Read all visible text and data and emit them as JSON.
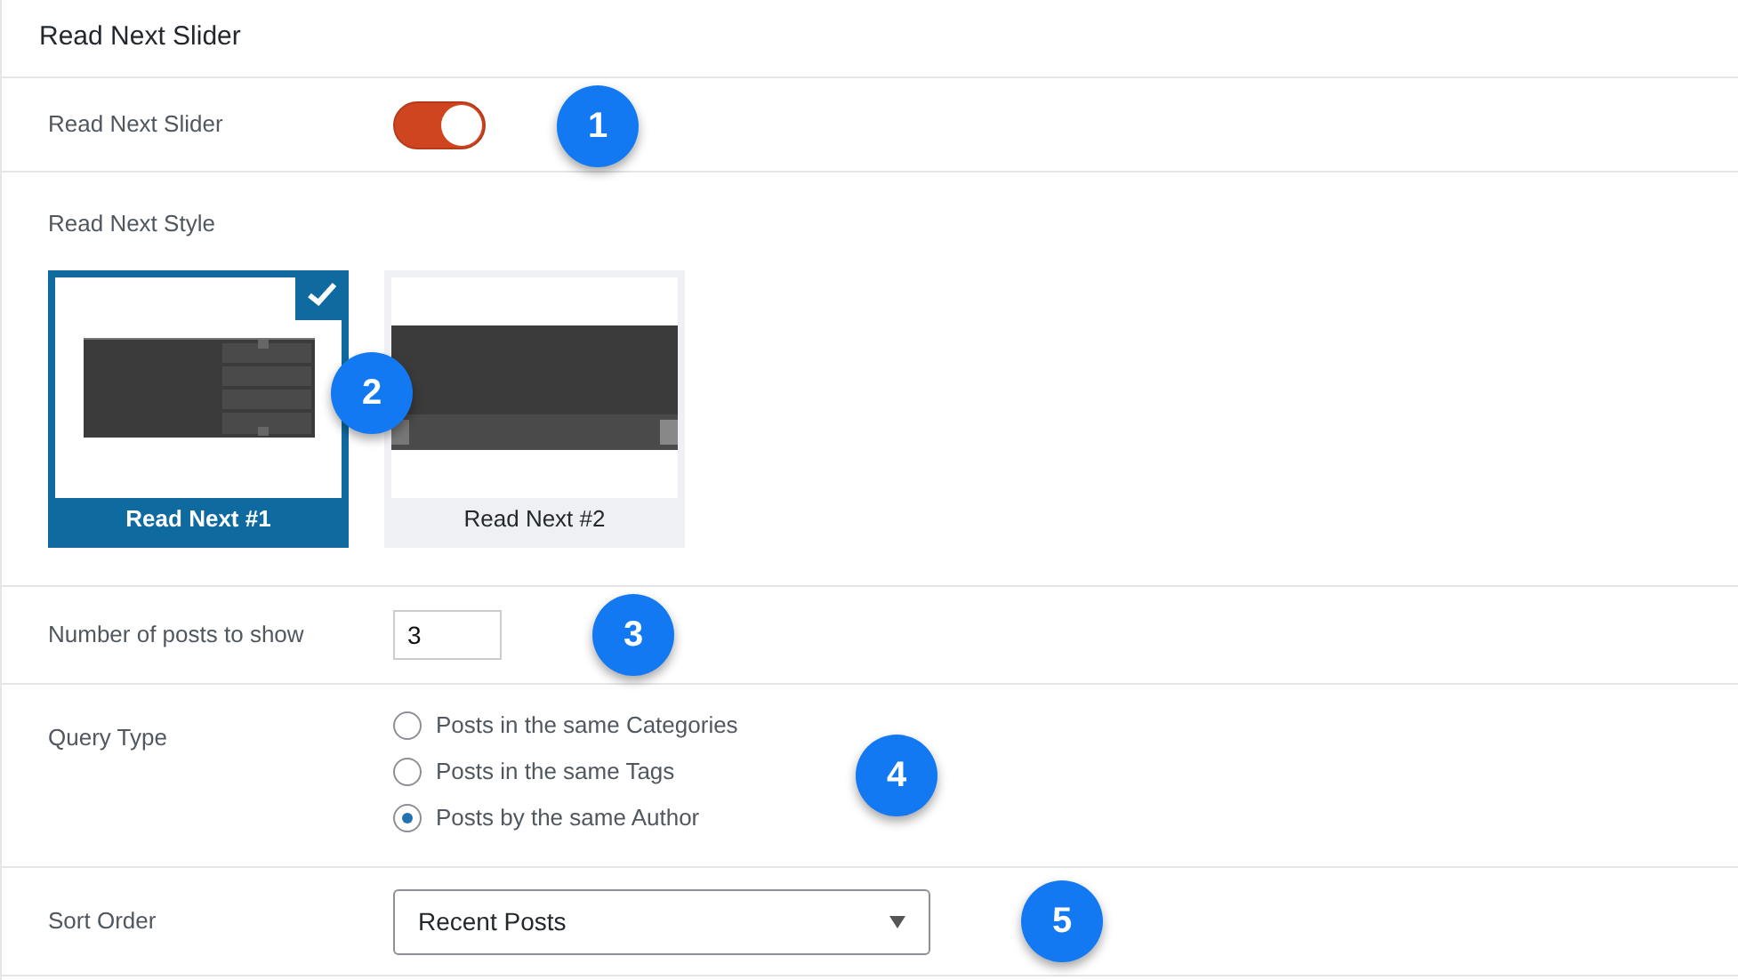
{
  "panel": {
    "title": "Read Next Slider"
  },
  "toggle_row": {
    "label": "Read Next Slider",
    "on": true,
    "callout": "1"
  },
  "style_row": {
    "label": "Read Next Style",
    "callout": "2",
    "styles": [
      {
        "label": "Read Next #1",
        "selected": true,
        "kind": "vertical"
      },
      {
        "label": "Read Next #2",
        "selected": false,
        "kind": "horizontal"
      }
    ]
  },
  "posts_row": {
    "label": "Number of posts to show",
    "value": "3",
    "callout": "3"
  },
  "query_row": {
    "label": "Query Type",
    "callout": "4",
    "options": [
      {
        "label": "Posts in the same Categories",
        "selected": false
      },
      {
        "label": "Posts in the same Tags",
        "selected": false
      },
      {
        "label": "Posts by the same Author",
        "selected": true
      }
    ]
  },
  "sort_row": {
    "label": "Sort Order",
    "value": "Recent Posts",
    "callout": "5"
  }
}
